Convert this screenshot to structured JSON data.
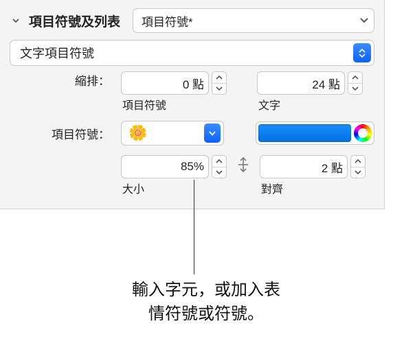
{
  "header": {
    "title": "項目符號及列表",
    "style_select": "項目符號*"
  },
  "type_select": "文字項目符號",
  "indent": {
    "label": "縮排：",
    "bullet_value": "0 點",
    "bullet_caption": "項目符號",
    "text_value": "24 點",
    "text_caption": "文字"
  },
  "bullet": {
    "label": "項目符號：",
    "emoji": "🌼",
    "color": "#0a7fe0"
  },
  "size": {
    "value": "85%",
    "caption": "大小"
  },
  "align": {
    "value": "2 點",
    "caption": "對齊"
  },
  "callout": {
    "line1": "輸入字元，或加入表",
    "line2": "情符號或符號。"
  }
}
